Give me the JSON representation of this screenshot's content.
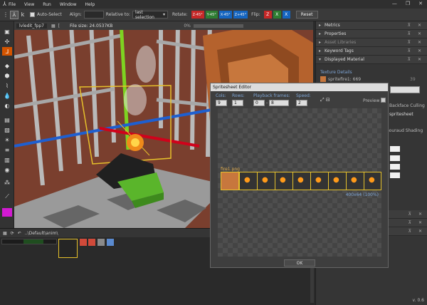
{
  "menu": [
    "File",
    "View",
    "Run",
    "Window",
    "Help"
  ],
  "toolbar": {
    "auto_select": "Auto-Select",
    "align": "Align:",
    "relative_to": "Relative to:",
    "relative_value": "last selection",
    "rotate": "Rotate:",
    "rot_buttons": [
      {
        "label": "Z-45°",
        "color": "#c62828"
      },
      {
        "label": "Y-45°",
        "color": "#2e7d32"
      },
      {
        "label": "X-45°",
        "color": "#1565c0"
      },
      {
        "label": "Z+45°",
        "color": "#c62828"
      }
    ],
    "flip": "Flip:",
    "flip_axes": [
      "Z",
      "X",
      "X"
    ],
    "reset": "Reset"
  },
  "viewport": {
    "tab": "lvledit_fpp7",
    "file_size": "File size: 24.0537KB",
    "zoom": "0%"
  },
  "right_panel": {
    "sections": [
      "Metrics",
      "Properties",
      "Asset Libraries",
      "Keyword Tags",
      "Displayed Material"
    ],
    "texture_details": "Texture Details",
    "texture_name": "spritefire1: 669",
    "texture_count": "39",
    "backface": "Backface Culling",
    "spritesheet": "spritesheet",
    "gouraud": "Gouraud Shading",
    "version": "v. 0.6"
  },
  "bottom": {
    "path": "..\\Default\\anim\\"
  },
  "spritesheet_editor": {
    "title": "Spritesheet Editor",
    "cols_label": "Cols:",
    "cols": "9",
    "rows_label": "Rows:",
    "rows": "1",
    "playback_label": "Playback frames:",
    "frame_from": "0",
    "frame_to": "8",
    "speed_label": "Speed:",
    "speed": "2",
    "preview": "Preview",
    "sheet_name": "fire1.png",
    "zoom_caption": "400x64 (100%)",
    "ok": "OK"
  },
  "colors": {
    "accent": "#7fa6d6",
    "selection": "#e6c12b",
    "magenta_swatch": "#d21ad2"
  }
}
